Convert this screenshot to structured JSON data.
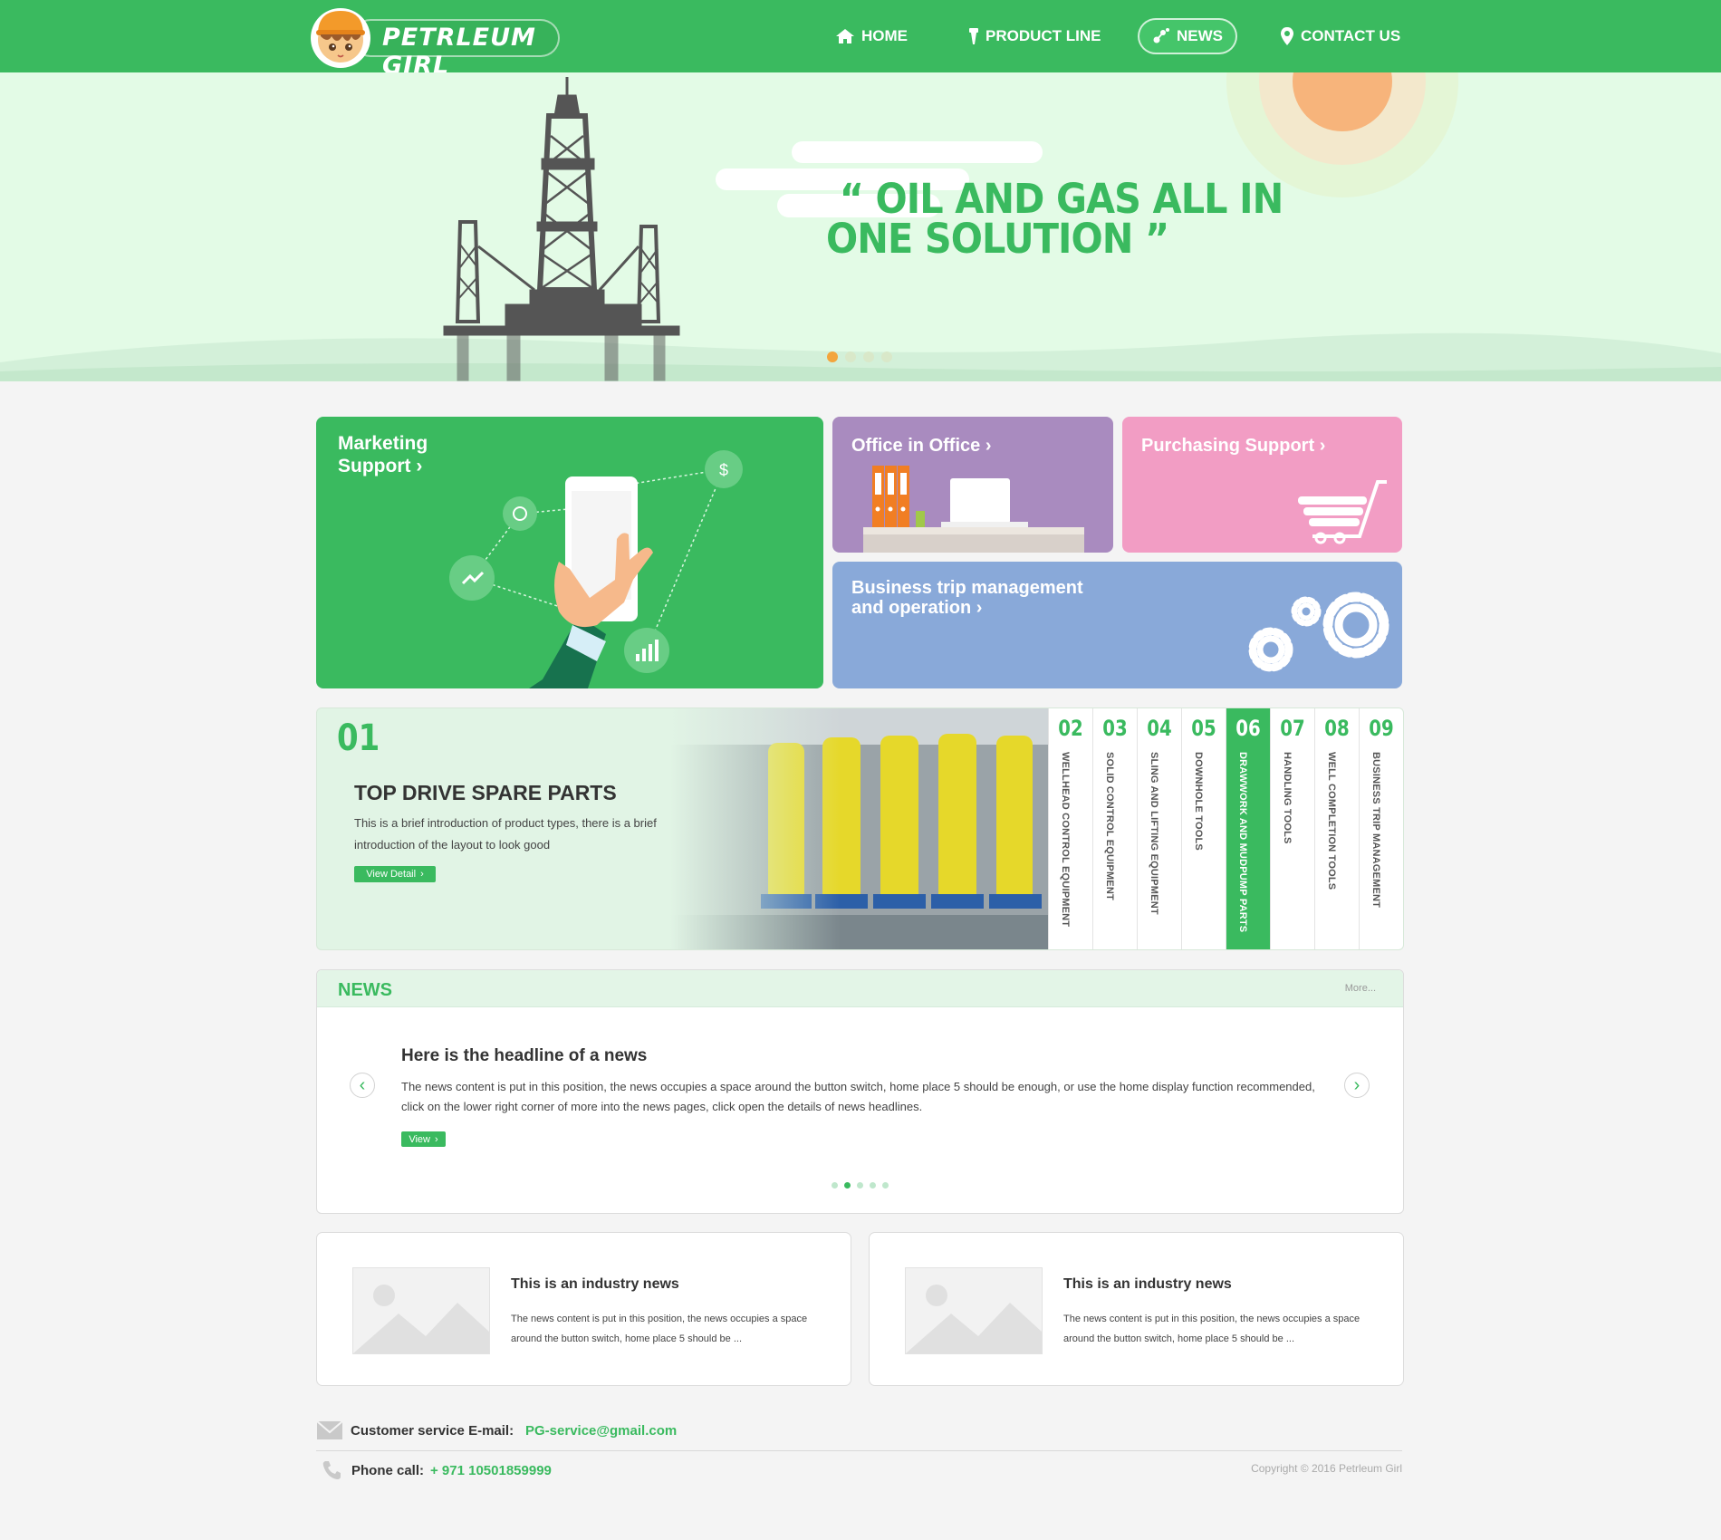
{
  "brand": {
    "name": "PETRLEUM GIRL"
  },
  "nav": [
    {
      "label": "HOME",
      "icon": "home-icon"
    },
    {
      "label": "PRODUCT LINE",
      "icon": "torch-icon"
    },
    {
      "label": "NEWS",
      "icon": "news-icon"
    },
    {
      "label": "CONTACT US",
      "icon": "location-pin-icon"
    }
  ],
  "hero": {
    "line1": "“ OIL AND GAS ALL IN",
    "line2": "ONE SOLUTION ”",
    "slides": 4,
    "active_slide": 1
  },
  "tiles": {
    "marketing": {
      "line1": "Marketing",
      "line2": "Support"
    },
    "office": {
      "label": "Office in Office"
    },
    "purchasing": {
      "label": "Purchasing Support"
    },
    "business": {
      "line1": "Business trip management",
      "line2": "and operation"
    }
  },
  "products": {
    "active_num": "01",
    "title": "TOP DRIVE SPARE PARTS",
    "desc": "This is a brief introduction of product types, there is a brief introduction of the layout to look good",
    "button": "View Detail",
    "tabs": [
      {
        "num": "02",
        "label": "WELLHEAD CONTROL EQUIPMENT"
      },
      {
        "num": "03",
        "label": "SOLID CONTROL EQUIPMENT"
      },
      {
        "num": "04",
        "label": "SLING AND LIFTING EQUIPMENT"
      },
      {
        "num": "05",
        "label": "DOWNHOLE TOOLS"
      },
      {
        "num": "06",
        "label": "DRAWWORK AND MUDPUMP PARTS"
      },
      {
        "num": "07",
        "label": "HANDLING TOOLS"
      },
      {
        "num": "08",
        "label": "WELL COMPLETION TOOLS"
      },
      {
        "num": "09",
        "label": "BUSINESS TRIP MANAGEMENT"
      }
    ],
    "active_tab": "06"
  },
  "news": {
    "title": "NEWS",
    "more": "More...",
    "headline": "Here is the headline of a news",
    "body": "The news content is put in this position, the news occupies a space around the button switch, home place 5 should be enough, or use the home display function recommended, click on the lower right corner of more into the news pages, click open the details of news headlines.",
    "button": "View",
    "dots": 5,
    "active_dot": 2
  },
  "industry_news": [
    {
      "title": "This is an industry news",
      "text": "The news content is put in this position, the news occupies a space around the button switch, home place 5 should be ..."
    },
    {
      "title": "This is an industry news",
      "text": "The news content is put in this position, the news occupies a space around the button switch, home place 5 should be ..."
    }
  ],
  "footer": {
    "email_label": "Customer service E-mail:",
    "email": "PG-service@gmail.com",
    "phone_label": "Phone call:",
    "phone": "+ 971 10501859999",
    "copyright": "Copyright © 2016 Petrleum Girl"
  },
  "colors": {
    "brand_green": "#3aba5f",
    "hero_bg": "#e3fbe6",
    "marketing": "#3aba5f",
    "office": "#a98bbf",
    "purchasing": "#f29dc4",
    "business": "#89a9d9"
  }
}
